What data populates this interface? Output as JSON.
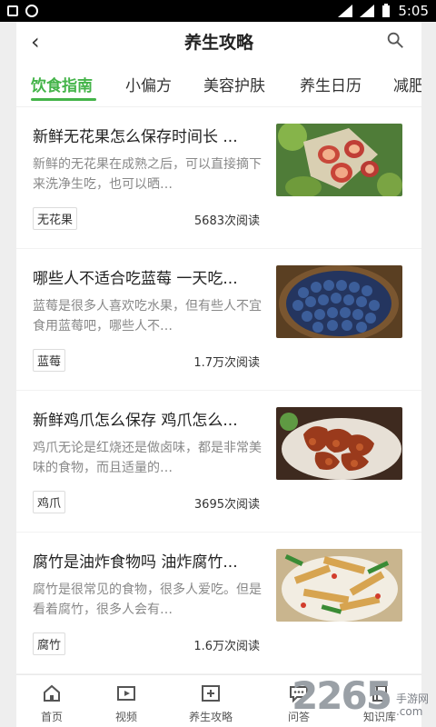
{
  "statusbar": {
    "time": "5:05",
    "icons": [
      "image-icon",
      "circle-icon",
      "signal-icon",
      "battery-icon"
    ]
  },
  "header": {
    "title": "养生攻略",
    "back_icon": "chevron-left-icon",
    "search_icon": "search-icon"
  },
  "tabs": [
    {
      "label": "饮食指南",
      "active": true
    },
    {
      "label": "小偏方",
      "active": false
    },
    {
      "label": "美容护肤",
      "active": false
    },
    {
      "label": "养生日历",
      "active": false
    },
    {
      "label": "减肥",
      "active": false
    }
  ],
  "articles": [
    {
      "title": "新鲜无花果怎么保存时间长 ...",
      "desc": "新鲜的无花果在成熟之后，可以直接摘下来洗净生吃，也可以晒…",
      "tag": "无花果",
      "reads": "5683次阅读",
      "thumb": "fig-image"
    },
    {
      "title": "哪些人不适合吃蓝莓 一天吃...",
      "desc": "蓝莓是很多人喜欢吃水果，但有些人不宜食用蓝莓吧，哪些人不…",
      "tag": "蓝莓",
      "reads": "1.7万次阅读",
      "thumb": "blueberry-image"
    },
    {
      "title": "新鲜鸡爪怎么保存 鸡爪怎么...",
      "desc": "鸡爪无论是红烧还是做卤味，都是非常美味的食物，而且适量的…",
      "tag": "鸡爪",
      "reads": "3695次阅读",
      "thumb": "chicken-feet-image"
    },
    {
      "title": "腐竹是油炸食物吗 油炸腐竹...",
      "desc": "腐竹是很常见的食物，很多人爱吃。但是看着腐竹，很多人会有…",
      "tag": "腐竹",
      "reads": "1.6万次阅读",
      "thumb": "tofu-skin-image"
    }
  ],
  "bottomnav": [
    {
      "label": "首页",
      "icon": "home-icon"
    },
    {
      "label": "视频",
      "icon": "video-icon"
    },
    {
      "label": "养生攻略",
      "icon": "plus-box-icon"
    },
    {
      "label": "问答",
      "icon": "chat-icon"
    },
    {
      "label": "知识库",
      "icon": "book-icon"
    }
  ],
  "watermark": {
    "number": "2265",
    "site": "手游网",
    "domain": ".com"
  },
  "colors": {
    "accent": "#44b449",
    "text": "#222222",
    "muted": "#888888"
  }
}
